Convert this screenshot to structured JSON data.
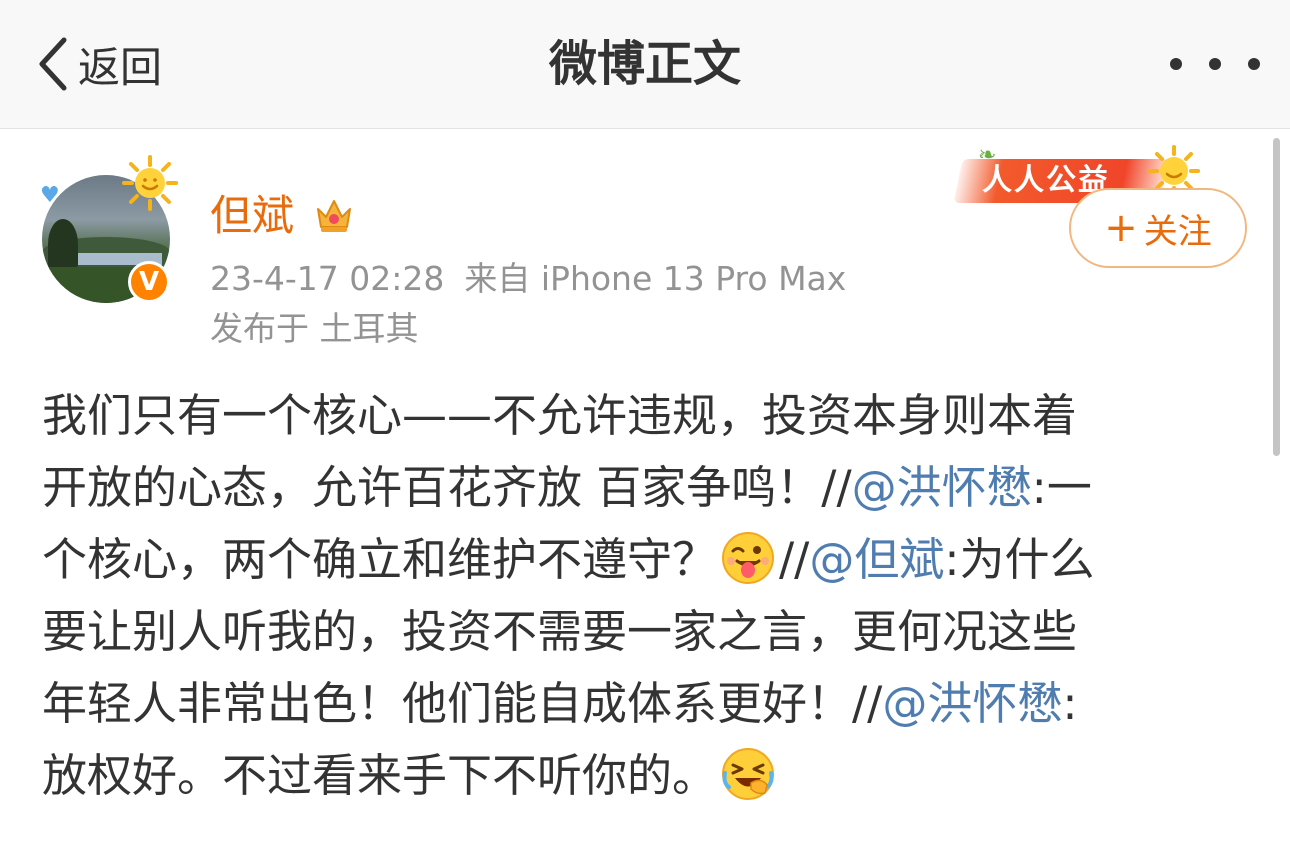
{
  "nav": {
    "back_label": "返回",
    "title": "微博正文"
  },
  "author": {
    "name": "但斌",
    "time": "23-4-17 02:28",
    "source": "来自 iPhone 13 Pro Max",
    "location": "发布于 土耳其",
    "verified_badge": "V"
  },
  "ribbon": {
    "text": "人人公益"
  },
  "follow": {
    "plus": "+",
    "label": "关注"
  },
  "post": {
    "line1": "我们只有一个核心——不允许违规，投资本身则本着",
    "line2_text": "开放的心态，允许百花齐放 百家争鸣！//",
    "line2_mention": "@洪怀懋",
    "line2_tail": ":一",
    "line3_text": "个核心，两个确立和维护不遵守？",
    "line3_after_emoji": "//",
    "line3_mention": "@但斌",
    "line3_tail": ":为什么",
    "line4": "要让别人听我的，投资不需要一家之言，更何况这些",
    "line5_text": "年轻人非常出色！他们能自成体系更好！//",
    "line5_mention": "@洪怀懋",
    "line5_tail": ":",
    "line6_text": "放权好。不过看来手下不听你的。"
  },
  "icons": {
    "back": "chevron-left-icon",
    "more": "more-dots-icon",
    "crown": "crown-icon",
    "sun": "sun-icon",
    "emoji_wink": "wink-tongue-emoji-icon",
    "emoji_laugh": "laugh-cry-emoji-icon"
  },
  "colors": {
    "accent": "#e86b0c",
    "mention": "#507daf",
    "meta": "#939393",
    "text": "#333333"
  }
}
